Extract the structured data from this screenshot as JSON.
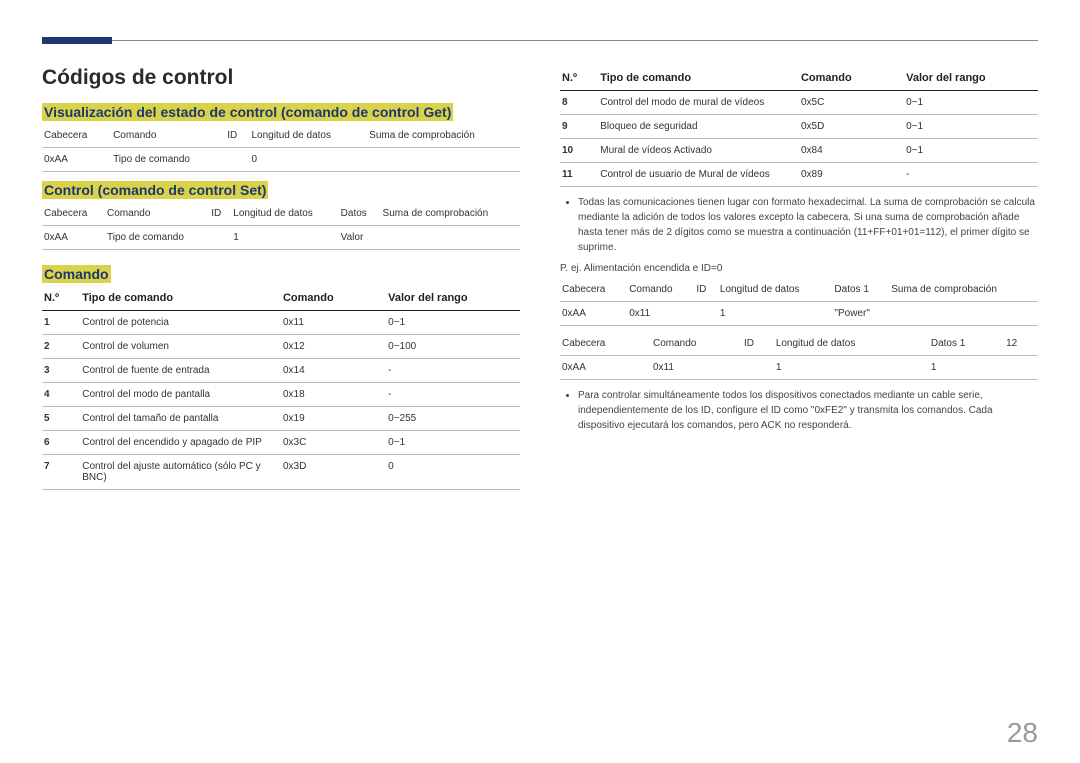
{
  "pageNumber": "28",
  "title": "Códigos de control",
  "sec1": {
    "heading": "Visualización del estado de control (comando de control Get)",
    "headers": [
      "Cabecera",
      "Comando",
      "ID",
      "Longitud de datos",
      "Suma de comprobación"
    ],
    "row": [
      "0xAA",
      "Tipo de comando",
      "",
      "0",
      ""
    ]
  },
  "sec2": {
    "heading": "Control (comando de control Set)",
    "headers": [
      "Cabecera",
      "Comando",
      "ID",
      "Longitud de datos",
      "Datos",
      "Suma de comprobación"
    ],
    "row": [
      "0xAA",
      "Tipo de comando",
      "",
      "1",
      "Valor",
      ""
    ]
  },
  "sec3": {
    "heading": "Comando",
    "headers": [
      "N.º",
      "Tipo de comando",
      "Comando",
      "Valor del rango"
    ],
    "rowsLeft": [
      [
        "1",
        "Control de potencia",
        "0x11",
        "0~1"
      ],
      [
        "2",
        "Control de volumen",
        "0x12",
        "0~100"
      ],
      [
        "3",
        "Control de fuente de entrada",
        "0x14",
        "-"
      ],
      [
        "4",
        "Control del modo de pantalla",
        "0x18",
        "-"
      ],
      [
        "5",
        "Control del tamaño de pantalla",
        "0x19",
        "0~255"
      ],
      [
        "6",
        "Control del encendido y apagado de PIP",
        "0x3C",
        "0~1"
      ],
      [
        "7",
        "Control del ajuste automático (sólo PC y BNC)",
        "0x3D",
        "0"
      ]
    ],
    "rowsRight": [
      [
        "8",
        "Control del modo de mural de vídeos",
        "0x5C",
        "0~1"
      ],
      [
        "9",
        "Bloqueo de seguridad",
        "0x5D",
        "0~1"
      ],
      [
        "10",
        "Mural de vídeos Activado",
        "0x84",
        "0~1"
      ],
      [
        "11",
        "Control de usuario de Mural de vídeos",
        "0x89",
        "-"
      ]
    ]
  },
  "note1": "Todas las comunicaciones tienen lugar con formato hexadecimal. La suma de comprobación se calcula mediante la adición de todos los valores excepto la cabecera. Si una suma de comprobación añade hasta tener más de 2 dígitos como se muestra a continuación (11+FF+01+01=112), el primer dígito se suprime.",
  "example_label": "P. ej. Alimentación encendida e ID=0",
  "ex1": {
    "headers": [
      "Cabecera",
      "Comando",
      "ID",
      "Longitud de datos",
      "Datos 1",
      "Suma de comprobación"
    ],
    "row": [
      "0xAA",
      "0x11",
      "",
      "1",
      "\"Power\"",
      ""
    ]
  },
  "ex2": {
    "headers": [
      "Cabecera",
      "Comando",
      "ID",
      "Longitud de datos",
      "Datos 1",
      "12"
    ],
    "row": [
      "0xAA",
      "0x11",
      "",
      "1",
      "1",
      ""
    ]
  },
  "note2": "Para controlar simultáneamente todos los dispositivos conectados mediante un cable serie, independientemente de los ID, configure el ID como \"0xFE2\" y transmita los comandos. Cada dispositivo ejecutará los comandos, pero ACK no responderá."
}
